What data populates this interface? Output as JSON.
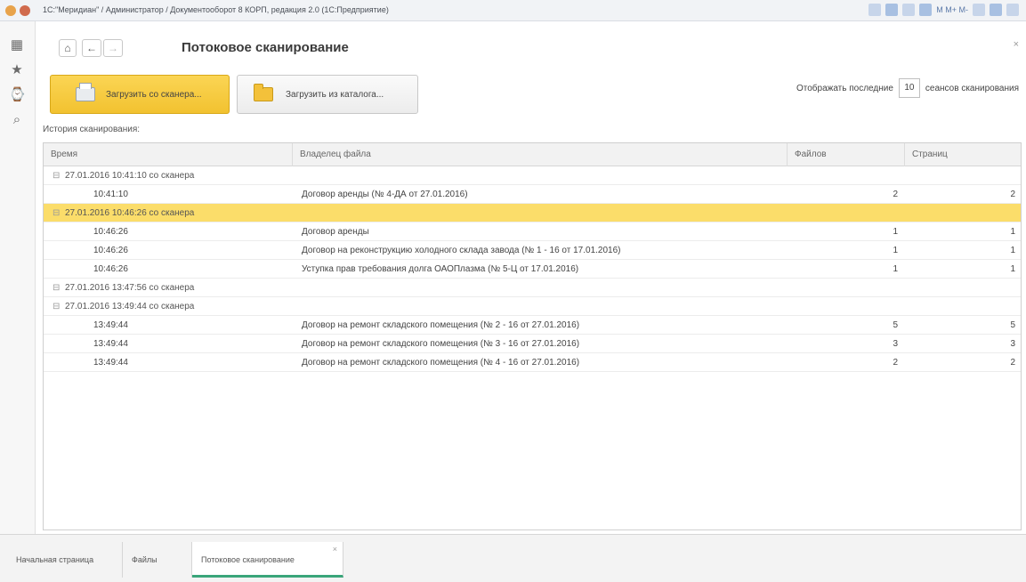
{
  "window": {
    "title": "1С:\"Меридиан\" / Администратор / Документооборот 8 КОРП, редакция 2.0 (1С:Предприятие)",
    "right_text": "M M+ M-"
  },
  "sidebar": {
    "items": [
      {
        "icon": "menu-grid-icon",
        "glyph": "▦"
      },
      {
        "icon": "star-icon",
        "glyph": "★"
      },
      {
        "icon": "history-icon",
        "glyph": "⌚"
      },
      {
        "icon": "search-icon",
        "glyph": "⌕"
      }
    ]
  },
  "header": {
    "home_glyph": "⌂",
    "back_glyph": "←",
    "forward_glyph": "→",
    "title": "Потоковое сканирование",
    "close_glyph": "×"
  },
  "actions": {
    "scan_label": "Загрузить со сканера...",
    "catalog_label": "Загрузить из каталога..."
  },
  "show_last": {
    "prefix": "Отображать последние",
    "value": "10",
    "suffix": "сеансов сканирования"
  },
  "history_label": "История сканирования:",
  "table": {
    "columns": [
      "Время",
      "Владелец файла",
      "Файлов",
      "Страниц"
    ],
    "rows": [
      {
        "type": "group",
        "time": "27.01.2016 10:41:10 со сканера",
        "owner": "",
        "files": "",
        "pages": ""
      },
      {
        "type": "item",
        "time": "10:41:10",
        "owner": "Договор аренды (№ 4-ДА от 27.01.2016)",
        "files": "2",
        "pages": "2"
      },
      {
        "type": "group",
        "selected": true,
        "time": "27.01.2016 10:46:26 со сканера",
        "owner": "",
        "files": "",
        "pages": ""
      },
      {
        "type": "item",
        "time": "10:46:26",
        "owner": "Договор аренды",
        "files": "1",
        "pages": "1"
      },
      {
        "type": "item",
        "time": "10:46:26",
        "owner": "Договор на реконструкцию холодного склада завода (№ 1 - 16 от 17.01.2016)",
        "files": "1",
        "pages": "1"
      },
      {
        "type": "item",
        "time": "10:46:26",
        "owner": "Уступка прав требования долга ОАОПлазма (№ 5-Ц от 17.01.2016)",
        "files": "1",
        "pages": "1"
      },
      {
        "type": "group",
        "time": "27.01.2016 13:47:56 со сканера",
        "owner": "",
        "files": "",
        "pages": ""
      },
      {
        "type": "group",
        "time": "27.01.2016 13:49:44 со сканера",
        "owner": "",
        "files": "",
        "pages": ""
      },
      {
        "type": "item",
        "time": "13:49:44",
        "owner": "Договор на ремонт складского помещения (№ 2 - 16 от 27.01.2016)",
        "files": "5",
        "pages": "5"
      },
      {
        "type": "item",
        "time": "13:49:44",
        "owner": "Договор на ремонт складского помещения (№ 3 - 16 от 27.01.2016)",
        "files": "3",
        "pages": "3"
      },
      {
        "type": "item",
        "time": "13:49:44",
        "owner": "Договор на ремонт складского помещения (№ 4 - 16 от 27.01.2016)",
        "files": "2",
        "pages": "2"
      }
    ]
  },
  "tabs": [
    {
      "label": "Начальная страница"
    },
    {
      "label": "Файлы"
    },
    {
      "label": "Потоковое сканирование",
      "active": true,
      "close_glyph": "×"
    }
  ],
  "colors": {
    "accent_yellow": "#f2c230",
    "selected_row": "#fbdd6a",
    "active_tab_underline": "#3aa57a"
  }
}
